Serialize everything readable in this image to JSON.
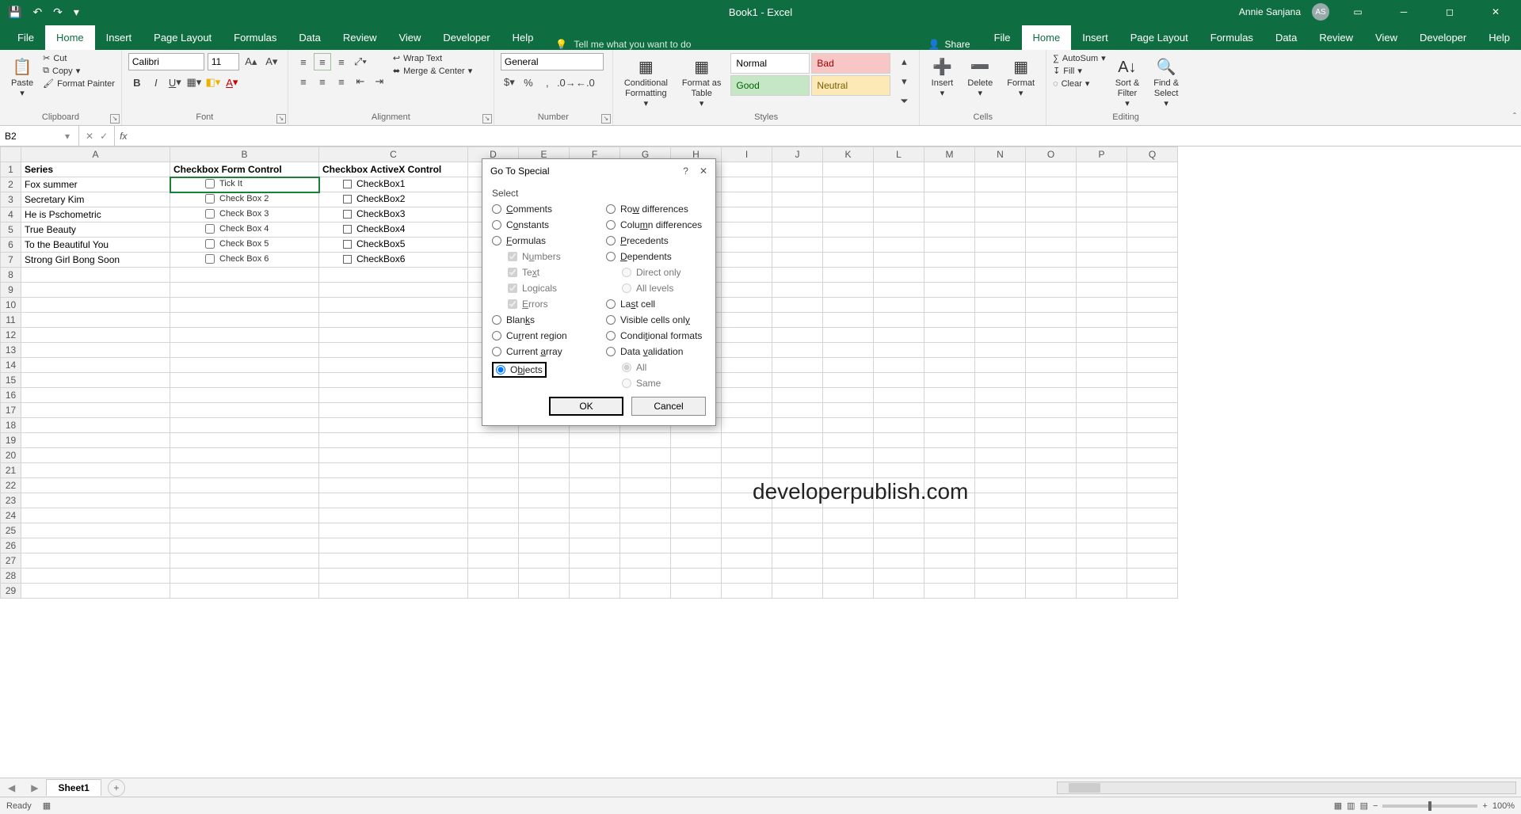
{
  "title": "Book1 - Excel",
  "user": {
    "name": "Annie Sanjana",
    "initials": "AS"
  },
  "qat": {
    "save": "💾",
    "undo": "↶",
    "redo": "↷"
  },
  "tabs": [
    "File",
    "Home",
    "Insert",
    "Page Layout",
    "Formulas",
    "Data",
    "Review",
    "View",
    "Developer",
    "Help"
  ],
  "active_tab": "Home",
  "tellme": "Tell me what you want to do",
  "share": "Share",
  "ribbon": {
    "clipboard": {
      "label": "Clipboard",
      "paste": "Paste",
      "cut": "Cut",
      "copy": "Copy",
      "painter": "Format Painter"
    },
    "font": {
      "label": "Font",
      "name": "Calibri",
      "size": "11"
    },
    "alignment": {
      "label": "Alignment",
      "wrap": "Wrap Text",
      "merge": "Merge & Center"
    },
    "number": {
      "label": "Number",
      "format": "General"
    },
    "styles": {
      "label": "Styles",
      "cond": "Conditional\nFormatting",
      "table": "Format as\nTable",
      "normal": "Normal",
      "bad": "Bad",
      "good": "Good",
      "neutral": "Neutral"
    },
    "cells": {
      "label": "Cells",
      "insert": "Insert",
      "delete": "Delete",
      "format": "Format"
    },
    "editing": {
      "label": "Editing",
      "autosum": "AutoSum",
      "fill": "Fill",
      "clear": "Clear",
      "sort": "Sort &\nFilter",
      "find": "Find &\nSelect"
    }
  },
  "name_box": "B2",
  "columns": [
    "A",
    "B",
    "C",
    "D",
    "E",
    "F",
    "G",
    "H",
    "I",
    "J",
    "K",
    "L",
    "M",
    "N",
    "O",
    "P",
    "Q"
  ],
  "rows": 29,
  "data": {
    "A1": "Series",
    "B1": "Checkbox Form Control",
    "C1": "Checkbox ActiveX Control",
    "A2": "Fox summer",
    "A3": "Secretary Kim",
    "A4": "He is Pschometric",
    "A5": "True Beauty",
    "A6": "To the Beautiful You",
    "A7": "Strong Girl Bong Soon"
  },
  "form_checks": [
    "Tick It",
    "Check Box 2",
    "Check Box 3",
    "Check Box 4",
    "Check Box 5",
    "Check Box 6"
  ],
  "ax_checks": [
    "CheckBox1",
    "CheckBox2",
    "CheckBox3",
    "CheckBox4",
    "CheckBox5",
    "CheckBox6"
  ],
  "watermark": "developerpublish.com",
  "sheet_tab": "Sheet1",
  "status": {
    "ready": "Ready",
    "zoom": "100%"
  },
  "dialog": {
    "title": "Go To Special",
    "select": "Select",
    "left": [
      {
        "t": "radio",
        "label": "Comments",
        "u": "C"
      },
      {
        "t": "radio",
        "label": "Constants",
        "u": "o"
      },
      {
        "t": "radio",
        "label": "Formulas",
        "u": "F"
      },
      {
        "t": "check",
        "label": "Numbers",
        "sub": true,
        "u": "u",
        "disabled": true,
        "checked": true
      },
      {
        "t": "check",
        "label": "Text",
        "sub": true,
        "u": "x",
        "disabled": true,
        "checked": true
      },
      {
        "t": "check",
        "label": "Logicals",
        "sub": true,
        "u": "g",
        "disabled": true,
        "checked": true
      },
      {
        "t": "check",
        "label": "Errors",
        "sub": true,
        "u": "E",
        "disabled": true,
        "checked": true
      },
      {
        "t": "radio",
        "label": "Blanks",
        "u": "k"
      },
      {
        "t": "radio",
        "label": "Current region",
        "u": "r"
      },
      {
        "t": "radio",
        "label": "Current array",
        "u": "a"
      },
      {
        "t": "radio",
        "label": "Objects",
        "u": "b",
        "checked": true,
        "boxed": true
      }
    ],
    "right": [
      {
        "t": "radio",
        "label": "Row differences",
        "u": "w"
      },
      {
        "t": "radio",
        "label": "Column differences",
        "u": "m"
      },
      {
        "t": "radio",
        "label": "Precedents",
        "u": "P"
      },
      {
        "t": "radio",
        "label": "Dependents",
        "u": "D"
      },
      {
        "t": "radio",
        "label": "Direct only",
        "sub": true,
        "disabled": true,
        "checked": true
      },
      {
        "t": "radio",
        "label": "All levels",
        "sub": true,
        "disabled": true
      },
      {
        "t": "radio",
        "label": "Last cell",
        "u": "s"
      },
      {
        "t": "radio",
        "label": "Visible cells only",
        "u": "y"
      },
      {
        "t": "radio",
        "label": "Conditional formats",
        "u": "t"
      },
      {
        "t": "radio",
        "label": "Data validation",
        "u": "v"
      },
      {
        "t": "radio",
        "label": "All",
        "sub": true,
        "disabled": true,
        "checked": true
      },
      {
        "t": "radio",
        "label": "Same",
        "sub": true,
        "disabled": true
      }
    ],
    "ok": "OK",
    "cancel": "Cancel"
  }
}
